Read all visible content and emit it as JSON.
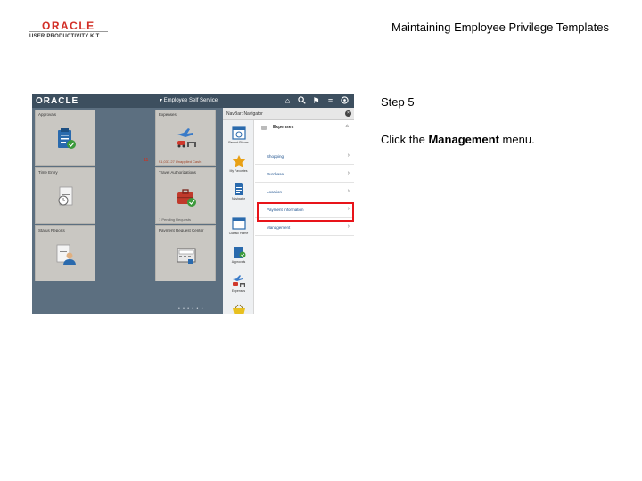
{
  "header": {
    "logo_main": "ORACLE",
    "logo_sub": "USER PRODUCTIVITY KIT",
    "doc_title": "Maintaining Employee Privilege Templates"
  },
  "instructions": {
    "step": "Step 5",
    "text_before": "Click the ",
    "text_bold": "Management",
    "text_after": " menu."
  },
  "screenshot": {
    "topbar": {
      "logo": "ORACLE",
      "title": "▾ Employee Self Service",
      "icons": [
        "home-icon",
        "search-icon",
        "flag-icon",
        "menu-icon",
        "navbar-icon"
      ]
    },
    "tiles": [
      {
        "title": "Approvals",
        "icon": "clipboard-check-icon"
      },
      {
        "title": "Expenses",
        "icon": "expenses-icon",
        "count": "11",
        "extra": "$1,037.27 Unapplied Cash"
      },
      {
        "title": "Time Entry",
        "icon": "clock-document-icon"
      },
      {
        "title": "Travel Authorizations",
        "icon": "briefcase-check-icon",
        "extra": "1  Pending Requests"
      },
      {
        "title": "Status Reports",
        "icon": "person-report-icon"
      },
      {
        "title": "Payment Request Center",
        "icon": "register-icon"
      }
    ],
    "page_dots": "• • • • • •",
    "navigator": {
      "header_title": "NavBar: Navigator",
      "close_icon": "close-icon",
      "left_items": [
        {
          "label": "Recent Places",
          "icon": "recent-places-icon"
        },
        {
          "label": "My Favorites",
          "icon": "star-icon"
        },
        {
          "label": "Navigator",
          "icon": "navigator-icon"
        },
        {
          "label": "Classic Home",
          "icon": "classic-home-icon"
        },
        {
          "label": "Approvals",
          "icon": "approvals-icon"
        },
        {
          "label": "Expenses",
          "icon": "expenses-icon"
        },
        {
          "label": "",
          "icon": "basket-icon"
        }
      ],
      "crumb": "Expenses",
      "items": [
        {
          "label": "Shopping"
        },
        {
          "label": "Purchase"
        },
        {
          "label": "Location"
        },
        {
          "label": "Payment Information"
        },
        {
          "label": "Management"
        }
      ]
    }
  },
  "colors": {
    "oracle_red": "#d22f27",
    "highlight": "#e8141a",
    "app_background": "#5c6f80",
    "topbar": "#3d4f5f",
    "tile": "#c9c7c2"
  }
}
